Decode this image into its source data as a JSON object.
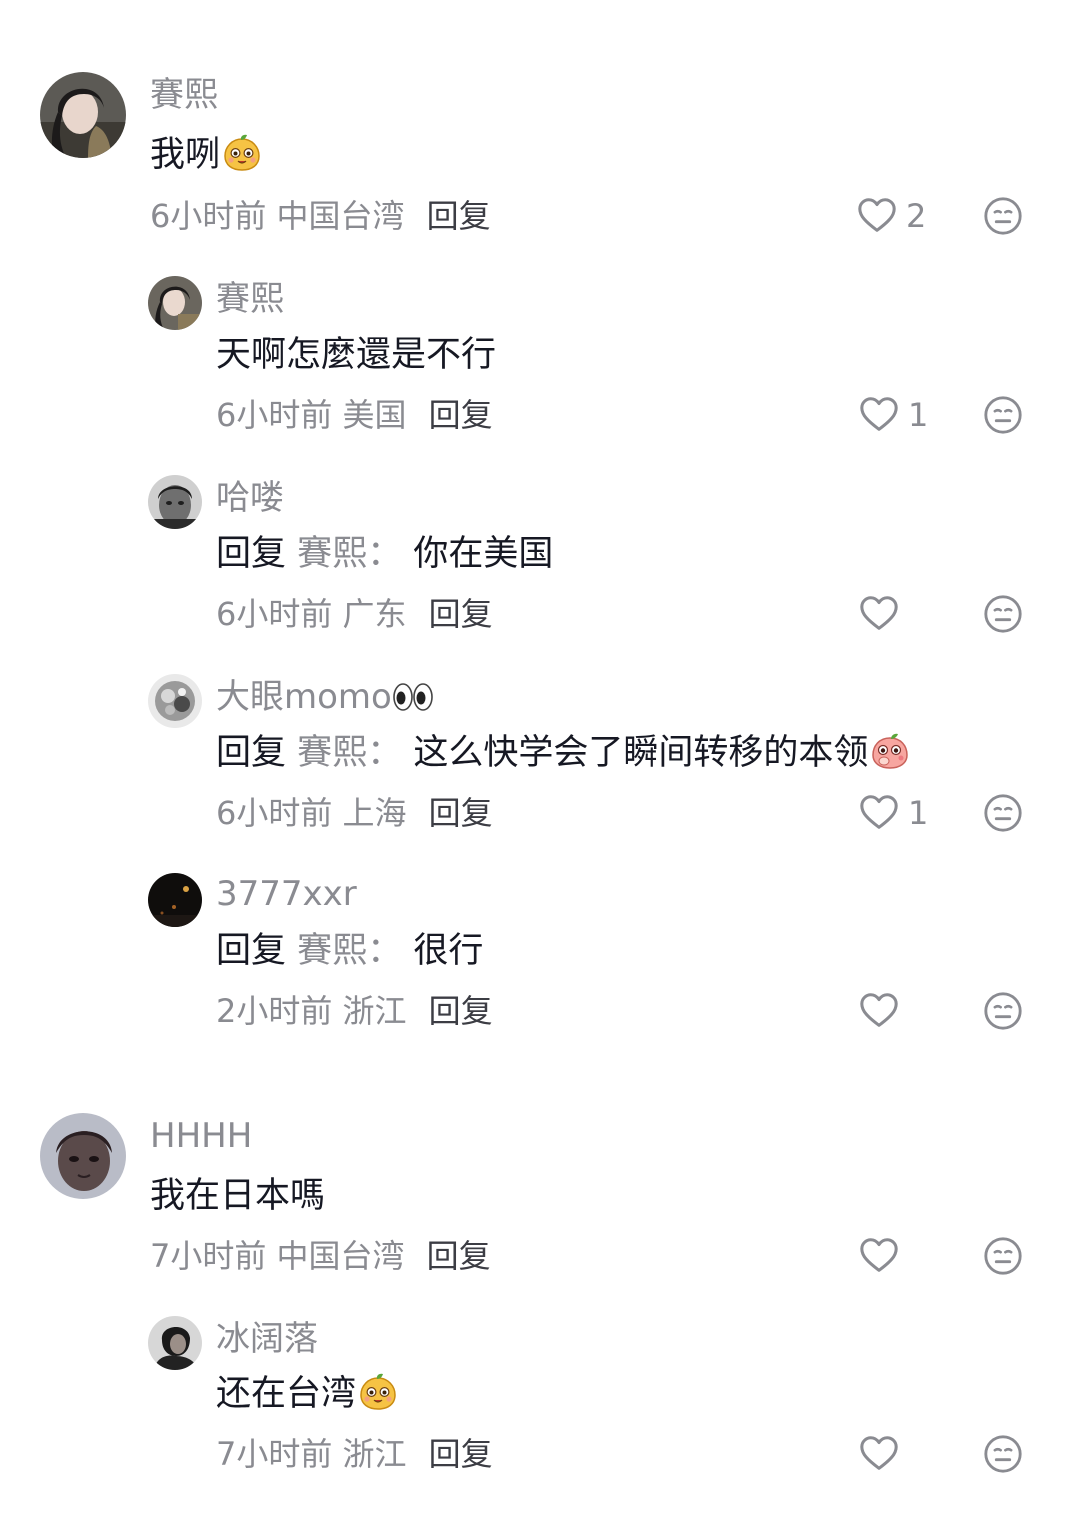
{
  "comments": [
    {
      "username": "賽熙",
      "text": "我咧",
      "time": "6小时前",
      "location": "中国台湾",
      "reply_label": "回复",
      "like_count": "2"
    },
    {
      "username": "賽熙",
      "text": "天啊怎麼還是不行",
      "time": "6小时前",
      "location": "美国",
      "reply_label": "回复",
      "like_count": "1"
    },
    {
      "username": "哈喽",
      "reply_word": "回复",
      "reply_target": "賽熙：",
      "text": "你在美国",
      "time": "6小时前",
      "location": "广东",
      "reply_label": "回复",
      "like_count": ""
    },
    {
      "username": "大眼momo",
      "reply_word": "回复",
      "reply_target": "賽熙：",
      "text": "这么快学会了瞬间转移的本领",
      "time": "6小时前",
      "location": "上海",
      "reply_label": "回复",
      "like_count": "1"
    },
    {
      "username": "3777xxr",
      "reply_word": "回复",
      "reply_target": "賽熙：",
      "text": "很行",
      "time": "2小时前",
      "location": "浙江",
      "reply_label": "回复",
      "like_count": ""
    },
    {
      "username": "HHHH",
      "text": "我在日本嗎",
      "time": "7小时前",
      "location": "中国台湾",
      "reply_label": "回复",
      "like_count": ""
    },
    {
      "username": "冰阔落",
      "text": "还在台湾",
      "time": "7小时前",
      "location": "浙江",
      "reply_label": "回复",
      "like_count": ""
    }
  ],
  "icons": {
    "like": "heart-outline-icon",
    "dislike": "neutral-face-icon",
    "emoji_smile": "orange-mascot-emoji",
    "emoji_shy": "peach-mascot-emoji",
    "eyes": "eyes-emoji"
  },
  "colors": {
    "username": "#8a8b91",
    "text": "#161823",
    "meta": "#8a8b91",
    "reply": "#3c3d44",
    "icon": "#8a8b91"
  }
}
